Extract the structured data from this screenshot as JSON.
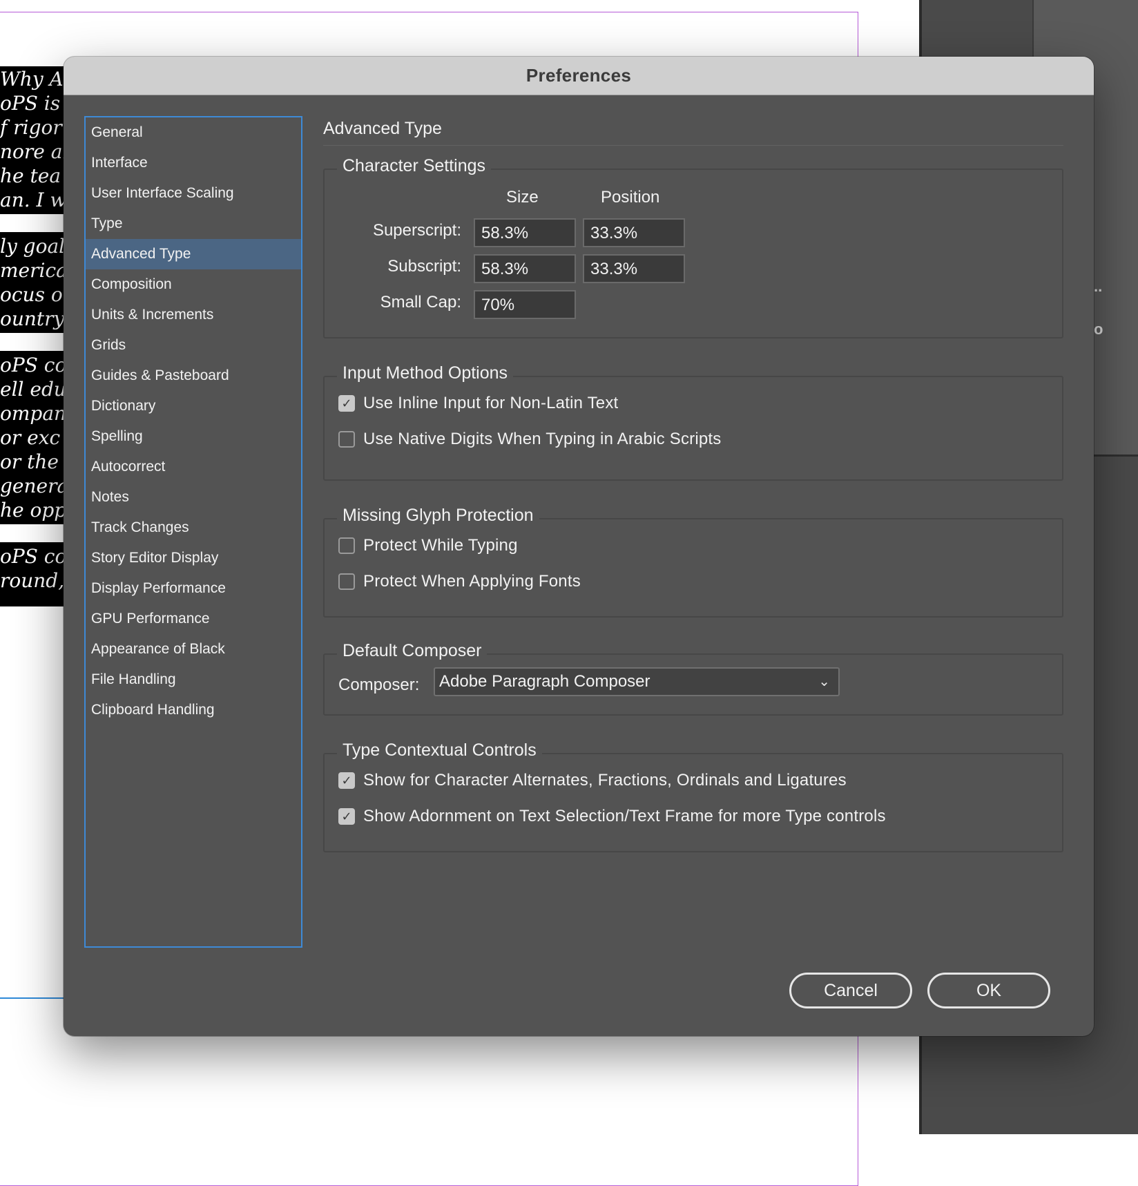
{
  "background": {
    "document_lines": [
      {
        "text": "Why Ad"
      },
      {
        "text": "oPS is"
      },
      {
        "text": "f rigor"
      },
      {
        "text": "nore ab"
      },
      {
        "text": "he tea"
      },
      {
        "text": "an. I w"
      },
      {
        "text": "ly goal"
      },
      {
        "text": "merica,"
      },
      {
        "text": "ocus o"
      },
      {
        "text": "ountry"
      },
      {
        "text": "oPS co"
      },
      {
        "text": "ell edu"
      },
      {
        "text": "ompany"
      },
      {
        "text": "or exc"
      },
      {
        "text": "or the"
      },
      {
        "text": " genera"
      },
      {
        "text": "he opp"
      },
      {
        "text": "oPS co"
      },
      {
        "text": "round,"
      }
    ],
    "panel_glyphs": [
      "..",
      "o"
    ]
  },
  "dialog": {
    "title": "Preferences",
    "sidebar": {
      "items": [
        {
          "label": "General"
        },
        {
          "label": "Interface"
        },
        {
          "label": "User Interface Scaling"
        },
        {
          "label": "Type"
        },
        {
          "label": "Advanced Type",
          "selected": true
        },
        {
          "label": "Composition"
        },
        {
          "label": "Units & Increments"
        },
        {
          "label": "Grids"
        },
        {
          "label": "Guides & Pasteboard"
        },
        {
          "label": "Dictionary"
        },
        {
          "label": "Spelling"
        },
        {
          "label": "Autocorrect"
        },
        {
          "label": "Notes"
        },
        {
          "label": "Track Changes"
        },
        {
          "label": "Story Editor Display"
        },
        {
          "label": "Display Performance"
        },
        {
          "label": "GPU Performance"
        },
        {
          "label": "Appearance of Black"
        },
        {
          "label": "File Handling"
        },
        {
          "label": "Clipboard Handling"
        }
      ]
    },
    "heading": "Advanced Type",
    "character_settings": {
      "title": "Character Settings",
      "size_header": "Size",
      "position_header": "Position",
      "superscript_label": "Superscript:",
      "superscript_size": "58.3%",
      "superscript_position": "33.3%",
      "subscript_label": "Subscript:",
      "subscript_size": "58.3%",
      "subscript_position": "33.3%",
      "small_cap_label": "Small Cap:",
      "small_cap_size": "70%"
    },
    "input_method": {
      "title": "Input Method Options",
      "inline_input": {
        "label": "Use Inline Input for Non-Latin Text",
        "checked": true
      },
      "native_digits": {
        "label": "Use Native Digits When Typing in Arabic Scripts",
        "checked": false
      }
    },
    "missing_glyph": {
      "title": "Missing Glyph Protection",
      "protect_typing": {
        "label": "Protect While Typing",
        "checked": false
      },
      "protect_fonts": {
        "label": "Protect When Applying Fonts",
        "checked": false
      }
    },
    "default_composer": {
      "title": "Default Composer",
      "label": "Composer:",
      "value": "Adobe Paragraph Composer"
    },
    "contextual_controls": {
      "title": "Type Contextual Controls",
      "char_alternates": {
        "label": "Show for Character Alternates, Fractions, Ordinals and Ligatures",
        "checked": true
      },
      "adornment": {
        "label": "Show Adornment on Text Selection/Text Frame for more Type controls",
        "checked": true
      }
    },
    "buttons": {
      "cancel": "Cancel",
      "ok": "OK"
    },
    "colors": {
      "dialog_bg": "#535353",
      "titlebar_bg": "#cfcfcf",
      "selection_bg": "#4b6684",
      "focus_border": "#3e8ad6"
    },
    "icons": {
      "checkmark": "checkmark-icon",
      "chevron": "chevron-down-icon"
    }
  }
}
